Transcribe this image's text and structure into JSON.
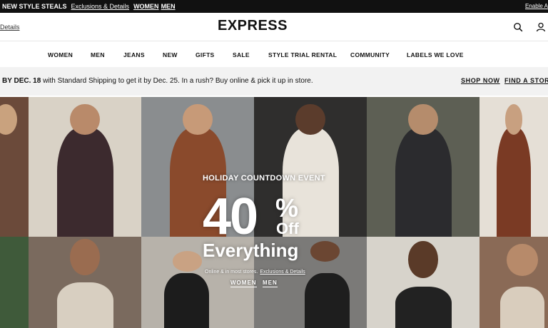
{
  "promo": {
    "title": "NEW STYLE STEALS",
    "exclusions": "Exclusions & Details",
    "women": "WOMEN",
    "men": "MEN",
    "accessible": "Enable A"
  },
  "header": {
    "details": "Details",
    "logo": "EXPRESS",
    "search_icon": "search-icon",
    "account_icon": "user-icon"
  },
  "nav": {
    "items": [
      "WOMEN",
      "MEN",
      "JEANS",
      "NEW",
      "GIFTS",
      "SALE",
      "STYLE TRIAL RENTAL",
      "COMMUNITY",
      "LABELS WE LOVE"
    ]
  },
  "shipping": {
    "bold": "BY DEC. 18",
    "text": "with Standard Shipping to get it by Dec. 25. In a rush? Buy online & pick it up in store.",
    "shop_now": "SHOP NOW",
    "find_store": "FIND A STOR"
  },
  "hero": {
    "event": "HOLIDAY COUNTDOWN EVENT",
    "percent": "40",
    "percent_sign": "%",
    "off": "Off",
    "everything": "Everything",
    "fine_print": "Online & in most stores.",
    "fine_link": "Exclusions & Details",
    "cta_women": "WOMEN",
    "cta_men": "MEN"
  },
  "colors": {
    "promo_bg": "#111111",
    "banner_bg": "#f2f2f2"
  }
}
